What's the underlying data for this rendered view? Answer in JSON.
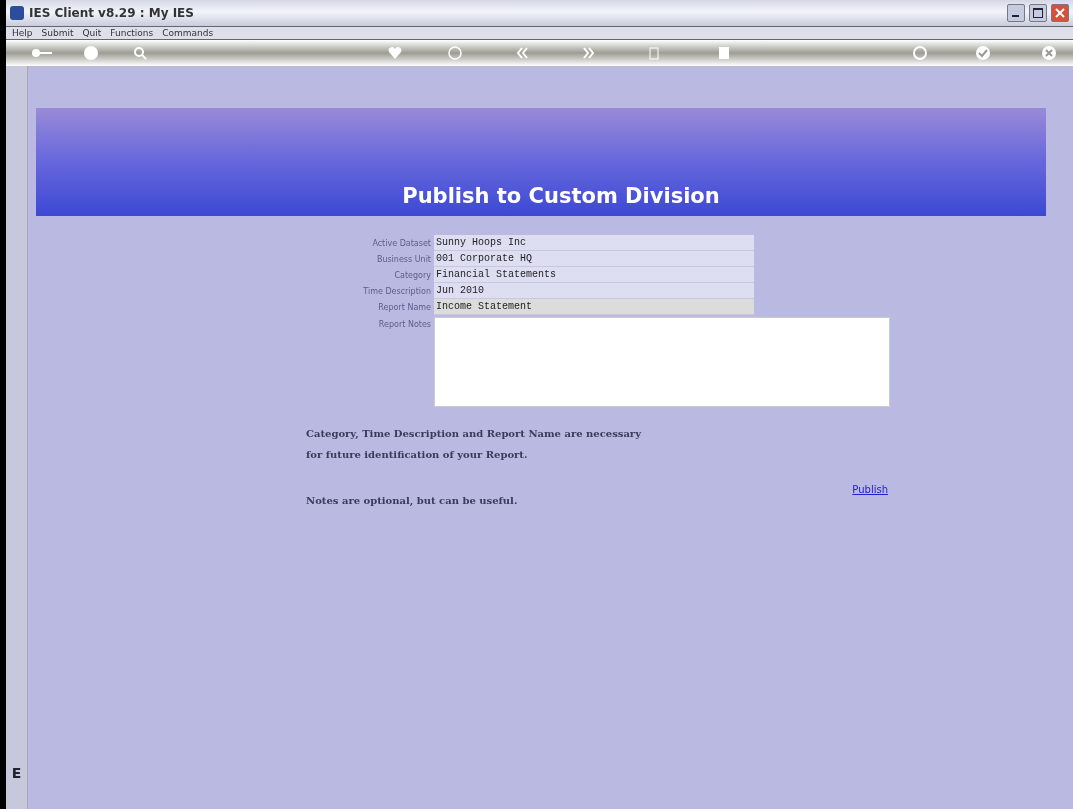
{
  "window": {
    "title": "IES Client v8.29 : My IES"
  },
  "menu": [
    "Help",
    "Submit",
    "Quit",
    "Functions",
    "Commands"
  ],
  "page": {
    "title": "Publish to Custom Division"
  },
  "fields": [
    {
      "label": "Active Dataset",
      "value": "Sunny Hoops Inc",
      "selected": false
    },
    {
      "label": "Business Unit",
      "value": "001 Corporate HQ",
      "selected": false
    },
    {
      "label": "Category",
      "value": "Financial Statements",
      "selected": false
    },
    {
      "label": "Time Description",
      "value": "Jun 2010",
      "selected": false
    },
    {
      "label": "Report Name",
      "value": "Income Statement",
      "selected": true
    }
  ],
  "notes": {
    "label": "Report Notes"
  },
  "messages": [
    "Category, Time Description and Report Name are necessary",
    "for future identification of your Report.",
    "Notes are optional, but can be useful."
  ],
  "publish_link": "Publish",
  "side_panel": {
    "letter": "E"
  }
}
